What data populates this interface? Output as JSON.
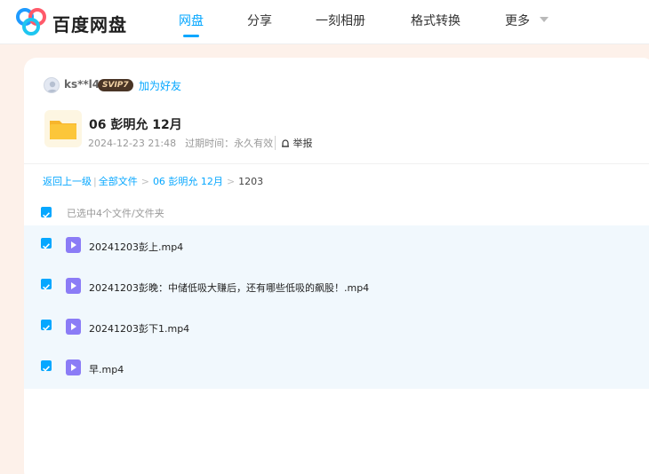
{
  "app": {
    "name": "百度网盘"
  },
  "nav": {
    "items": [
      "网盘",
      "分享",
      "一刻相册",
      "格式转换",
      "更多"
    ],
    "active_index": 0
  },
  "share": {
    "owner": "ks**l4",
    "badge": "SVIP7",
    "add_friend": "加为好友",
    "title": "06 彭明允 12月",
    "date": "2024-12-23 21:48",
    "expire": "过期时间：永久有效",
    "report": "举报"
  },
  "breadcrumb": {
    "back": "返回上一级",
    "all_files": "全部文件",
    "folder": "06 彭明允 12月",
    "current": "1203"
  },
  "selection": {
    "label": "已选中4个文件/文件夹"
  },
  "files": [
    {
      "name": "20241203彭上.mp4",
      "checked": true
    },
    {
      "name": "20241203彭晚：中储低吸大赚后，还有哪些低吸的飙股！.mp4",
      "checked": true
    },
    {
      "name": "20241203彭下1.mp4",
      "checked": true
    },
    {
      "name": "早.mp4",
      "checked": true
    }
  ],
  "colors": {
    "accent": "#06a7ff",
    "page_bg": "#fdf1ea",
    "list_bg": "#f1f8fd",
    "video_icon": "#8b7cf6",
    "folder": "#fcc63a"
  }
}
